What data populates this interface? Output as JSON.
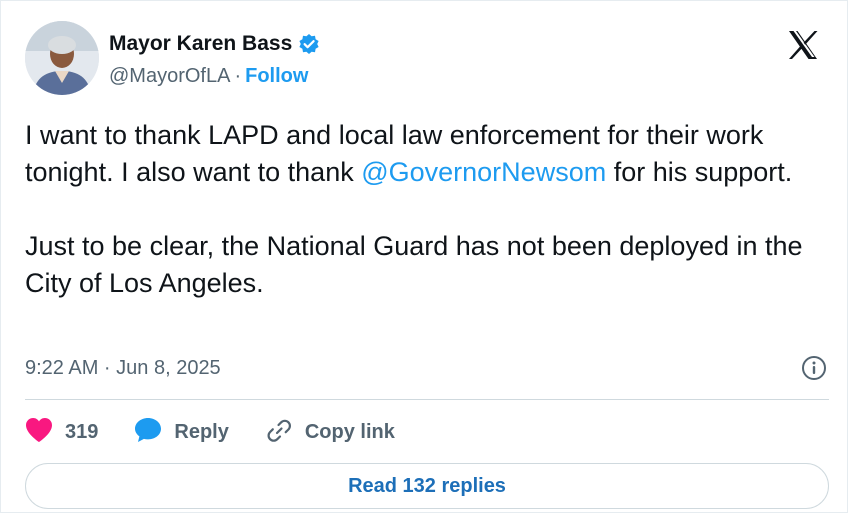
{
  "author": {
    "display_name": "Mayor Karen Bass",
    "handle": "@MayorOfLA",
    "separator": "·",
    "follow_label": "Follow",
    "verified_icon": "verified-badge-icon",
    "avatar": "profile-photo"
  },
  "brand": {
    "logo_icon": "x-logo-icon"
  },
  "tweet": {
    "text_part1": "I want to thank LAPD and local law enforcement for their work tonight. I also want to thank ",
    "mention": "@GovernorNewsom",
    "text_part2": " for his support.",
    "paragraph2": "Just to be clear, the National Guard has not been deployed in the City of Los Angeles.",
    "timestamp": "9:22 AM · Jun 8, 2025",
    "info_icon": "info-icon"
  },
  "actions": {
    "like_count": "319",
    "reply_label": "Reply",
    "copy_link_label": "Copy link",
    "like_icon": "heart-icon",
    "reply_icon": "speech-bubble-icon",
    "copy_icon": "link-icon"
  },
  "footer": {
    "read_replies_label": "Read 132 replies"
  },
  "colors": {
    "accent": "#1d9bf0",
    "heart": "#f91880",
    "text": "#0f1419",
    "muted": "#536471"
  }
}
